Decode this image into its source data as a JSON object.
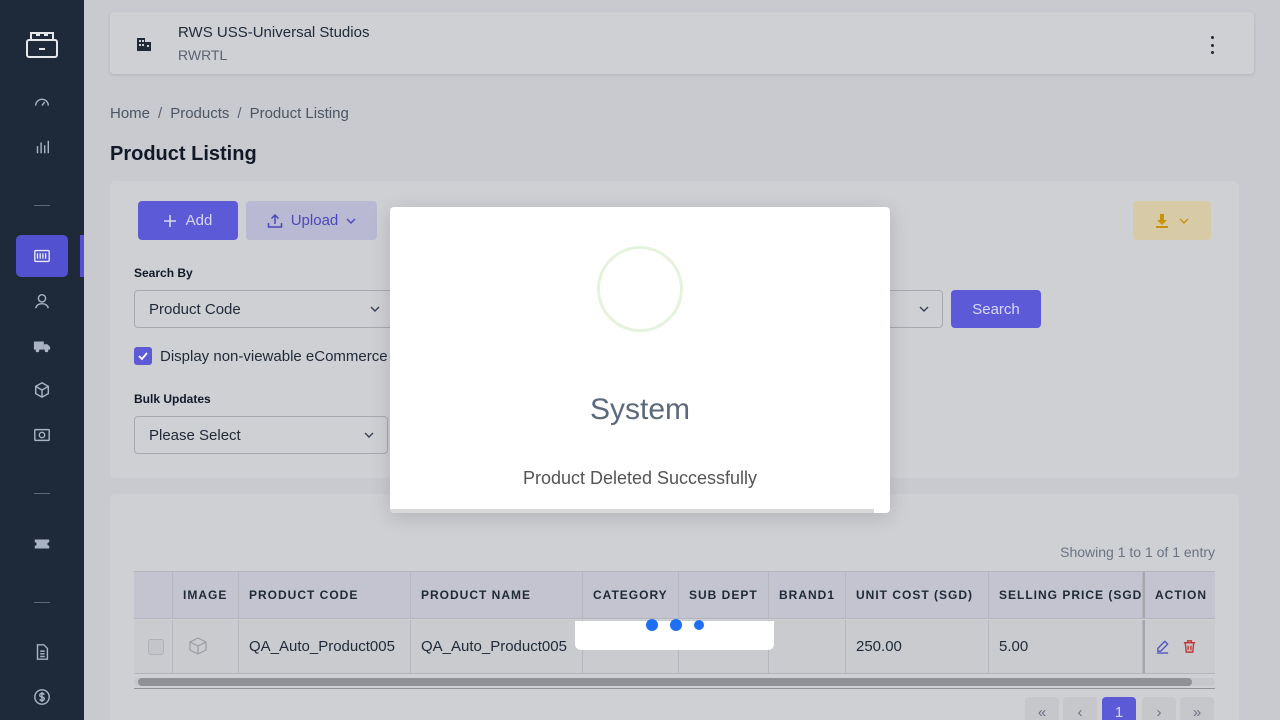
{
  "sidebar": {
    "items": [
      {
        "name": "logo-icon"
      },
      {
        "name": "dashboard-icon"
      },
      {
        "name": "reports-icon"
      },
      {
        "name": "barcode-icon",
        "active": true
      },
      {
        "name": "user-icon"
      },
      {
        "name": "truck-icon"
      },
      {
        "name": "box-icon"
      },
      {
        "name": "camera-icon"
      },
      {
        "name": "ticket-icon"
      },
      {
        "name": "document-icon"
      },
      {
        "name": "dollar-icon"
      }
    ]
  },
  "topbar": {
    "org_name": "RWS USS-Universal Studios",
    "org_code": "RWRTL"
  },
  "breadcrumb": [
    "Home",
    "Products",
    "Product Listing"
  ],
  "breadcrumb_sep": "/",
  "page_title": "Product Listing",
  "toolbar": {
    "add_label": "Add",
    "upload_label": "Upload"
  },
  "filters": {
    "search_by_label": "Search By",
    "search_by_value": "Product Code",
    "display_checkbox_label": "Display non-viewable eCommerce",
    "display_checked": true,
    "search_button": "Search",
    "bulk_updates_label": "Bulk Updates",
    "bulk_updates_value": "Please Select"
  },
  "table": {
    "showing_text": "Showing 1 to 1 of 1 entry",
    "columns": [
      "IMAGE",
      "PRODUCT CODE",
      "PRODUCT NAME",
      "CATEGORY",
      "SUB DEPT",
      "BRAND1",
      "UNIT COST (SGD)",
      "SELLING PRICE (SGD",
      "ACTION"
    ],
    "rows": [
      {
        "product_code": "QA_Auto_Product005",
        "product_name": "QA_Auto_Product005",
        "category": "",
        "sub_dept": "",
        "brand1": "",
        "unit_cost": "250.00",
        "selling_price": "5.00"
      }
    ]
  },
  "pagination": {
    "first": "«",
    "prev": "‹",
    "current": "1",
    "next": "›",
    "last": "»"
  },
  "modal": {
    "title": "System",
    "message": "Product Deleted Successfully"
  },
  "colors": {
    "primary": "#5c5ad6",
    "sidebar": "#1e2a3a",
    "loader_dot": "#1f6ff5"
  }
}
